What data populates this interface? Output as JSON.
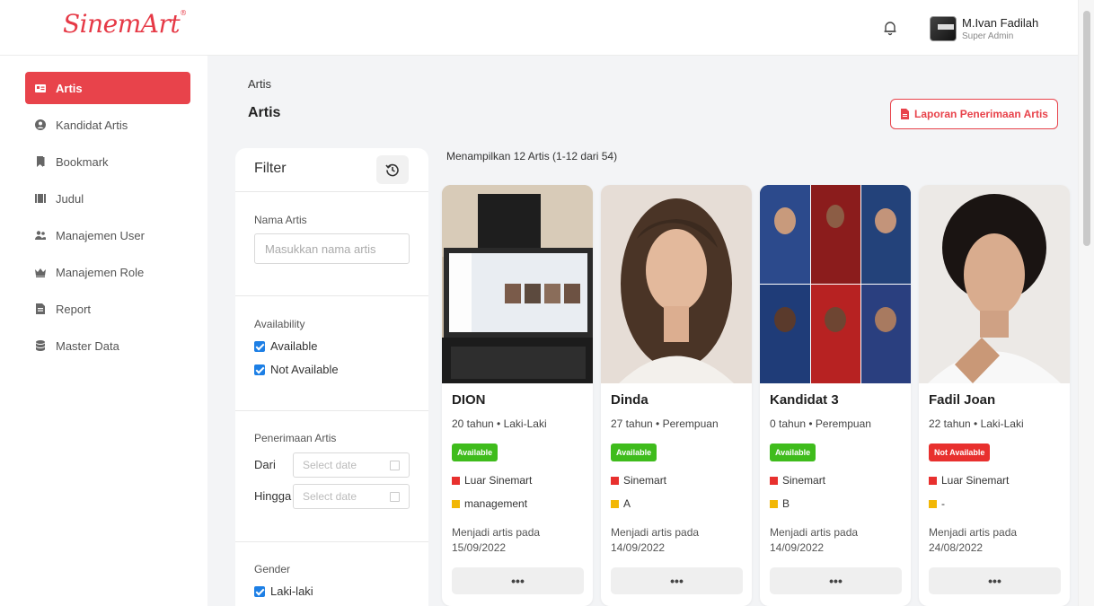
{
  "header": {
    "logo": "SinemArt",
    "logo_mark": "®",
    "user_name": "M.Ivan Fadilah",
    "user_role": "Super Admin"
  },
  "sidebar": {
    "items": [
      {
        "label": "Artis",
        "icon": "id-card-icon",
        "active": true
      },
      {
        "label": "Kandidat Artis",
        "icon": "user-circle-icon"
      },
      {
        "label": "Bookmark",
        "icon": "bookmark-icon"
      },
      {
        "label": "Judul",
        "icon": "film-icon"
      },
      {
        "label": "Manajemen User",
        "icon": "users-icon"
      },
      {
        "label": "Manajemen Role",
        "icon": "crown-icon"
      },
      {
        "label": "Report",
        "icon": "file-icon"
      },
      {
        "label": "Master Data",
        "icon": "database-icon"
      }
    ]
  },
  "main": {
    "breadcrumb": "Artis",
    "title": "Artis",
    "report_button": "Laporan Penerimaan Artis",
    "result_info": "Menampilkan 12 Artis (1-12 dari 54)"
  },
  "filter": {
    "title": "Filter",
    "name_label": "Nama Artis",
    "name_placeholder": "Masukkan nama artis",
    "availability_label": "Availability",
    "availability_options": [
      "Available",
      "Not Available"
    ],
    "penerimaan_label": "Penerimaan Artis",
    "from_label": "Dari",
    "to_label": "Hingga",
    "date_placeholder": "Select date",
    "gender_label": "Gender",
    "gender_options": [
      "Laki-laki"
    ]
  },
  "cards": [
    {
      "name": "DION",
      "meta": "20 tahun • Laki-Laki",
      "status": "Available",
      "available": true,
      "origin": "Luar Sinemart",
      "group": "management",
      "since_label": "Menjadi artis pada",
      "since_date": "15/09/2022",
      "more": "•••"
    },
    {
      "name": "Dinda",
      "meta": "27 tahun • Perempuan",
      "status": "Available",
      "available": true,
      "origin": "Sinemart",
      "group": "A",
      "since_label": "Menjadi artis pada",
      "since_date": "14/09/2022",
      "more": "•••"
    },
    {
      "name": "Kandidat 3",
      "meta": "0 tahun • Perempuan",
      "status": "Available",
      "available": true,
      "origin": "Sinemart",
      "group": "B",
      "since_label": "Menjadi artis pada",
      "since_date": "14/09/2022",
      "more": "•••"
    },
    {
      "name": "Fadil Joan",
      "meta": "22 tahun • Laki-Laki",
      "status": "Not Available",
      "available": false,
      "origin": "Luar Sinemart",
      "group": "-",
      "since_label": "Menjadi artis pada",
      "since_date": "24/08/2022",
      "more": "•••"
    }
  ],
  "colors": {
    "accent": "#e8434b",
    "available": "#3fbc1c",
    "not_available": "#e8302e",
    "checkbox": "#1d7fe5"
  }
}
